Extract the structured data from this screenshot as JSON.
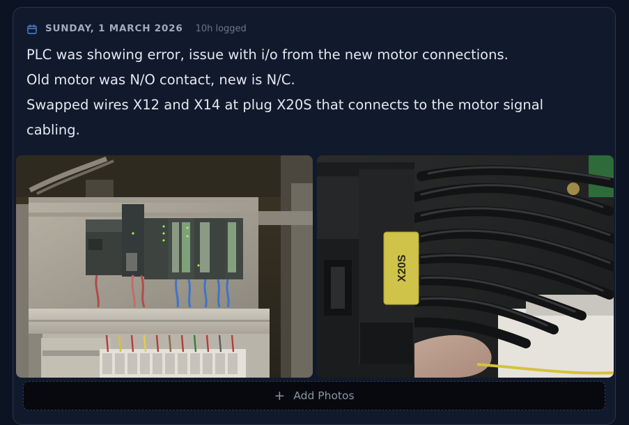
{
  "entry": {
    "date": "SUNDAY, 1 MARCH 2026",
    "logged": "10h logged",
    "lines": [
      "PLC was showing error, issue with i/o from the new motor connections.",
      "Old motor was N/O contact, new is N/C.",
      "Swapped wires X12 and X14 at plug X20S that connects to the motor signal",
      "cabling."
    ]
  },
  "photos": [
    {
      "subject": "PLC control cabinet"
    },
    {
      "subject": "X20S plug connector",
      "label": "X20S"
    }
  ],
  "add_photos": {
    "icon": "plus-icon",
    "label": "Add Photos"
  },
  "icons": {
    "date": "calendar-icon"
  },
  "colors": {
    "background": "#0c1322",
    "card": "#111a2c",
    "accent_icon": "#4f86d9",
    "text": "#e3e8f0",
    "muted": "#a0abbe"
  }
}
